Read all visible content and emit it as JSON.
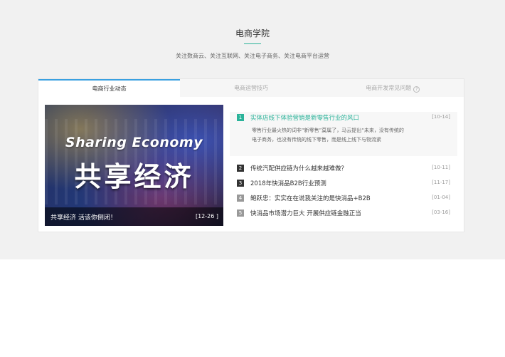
{
  "section": {
    "title": "电商学院",
    "subtitle": "关注数商云、关注互联网、关注电子商务、关注电商平台运营"
  },
  "tabs": [
    {
      "label": "电商行业动态",
      "active": true
    },
    {
      "label": "电商运营技巧",
      "active": false
    },
    {
      "label": "电商开发常见问题",
      "active": false,
      "icon": "help-icon"
    }
  ],
  "banner": {
    "image_text_en": "Sharing Economy",
    "image_text_cn": "共享经济",
    "caption": "共享经济 活该你倒闭！",
    "date": "[12-26 ]"
  },
  "articles": [
    {
      "num": "1",
      "title": "实体店线下体验营销是新零售行业的风口",
      "date": "[10-14]",
      "desc": "零售行业最火热的词非“新零售”莫属了，马云提出“未来，没有传统的电子商务，也没有传统的线下零售，而是线上线下与物流紧",
      "highlight": true
    },
    {
      "num": "2",
      "title": "传统汽配供应链为什么越来越难做？",
      "date": "[10-11]"
    },
    {
      "num": "3",
      "title": "2018年快消品B2B行业预测",
      "date": "[11-17]"
    },
    {
      "num": "4",
      "title": "鲍跃忠：实实在在说我关注的是快消品+B2B",
      "date": "[01-04]"
    },
    {
      "num": "5",
      "title": "快消品市场潜力巨大 开展供应链金融正当",
      "date": "[03-16]"
    }
  ],
  "colors": {
    "accent_green": "#2bb39a",
    "tab_active_border": "#3aa0e0",
    "page_bg": "#f1f1f1"
  }
}
